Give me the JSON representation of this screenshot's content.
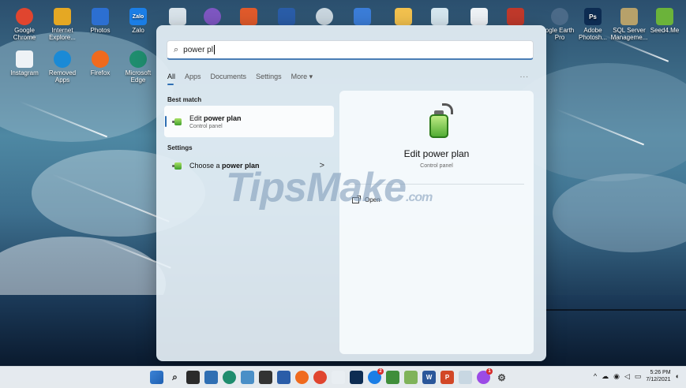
{
  "desktop": {
    "icons_left": [
      {
        "label": "Google Chrome",
        "color": "#e0452f"
      },
      {
        "label": "Internet Explore...",
        "color": "#e5a823"
      },
      {
        "label": "Photos",
        "color": "#2c6fd1"
      },
      {
        "label": "Zalo",
        "color": "#1b7ee6"
      },
      {
        "label": "Instagram",
        "color": "#3f51b5"
      },
      {
        "label": "Removed Apps",
        "color": "#1a8ad6"
      },
      {
        "label": "Firefox",
        "color": "#f06a1d"
      },
      {
        "label": "Microsoft Edge",
        "color": "#1f8d6e"
      }
    ],
    "icons_right": [
      {
        "label": "ogle Earth Pro",
        "color": "#4b6a88"
      },
      {
        "label": "Adobe Photosh...",
        "color": "#0d2c52"
      },
      {
        "label": "SQL Server Manageme...",
        "color": "#b7a16a"
      },
      {
        "label": "Seed4.Me",
        "color": "#6bb33a"
      }
    ],
    "zalo_badge": "Zalo",
    "photoshop_badge": "Ps"
  },
  "search": {
    "query": "power pl",
    "tabs": [
      {
        "label": "All",
        "active": true
      },
      {
        "label": "Apps"
      },
      {
        "label": "Documents"
      },
      {
        "label": "Settings"
      },
      {
        "label": "More ▾"
      }
    ],
    "more_menu": "...",
    "best_match_label": "Best match",
    "best_match": {
      "title_plain": "Edit ",
      "title_bold": "power plan",
      "subtitle": "Control panel"
    },
    "settings_label": "Settings",
    "settings_result": {
      "title_plain": "Choose a ",
      "title_bold": "power plan",
      "chevron": ">"
    },
    "detail": {
      "title": "Edit power plan",
      "subtitle": "Control panel",
      "action_open": "Open"
    }
  },
  "watermark": {
    "main": "TipsMake",
    "suffix": ".com"
  },
  "taskbar": {
    "badges": {
      "mail": "2",
      "messenger": "1"
    },
    "word_label": "W",
    "ppt_label": "P",
    "clock_time": "5:26 PM",
    "clock_date": "7/12/2021"
  },
  "colors": {
    "accent": "#2f6fb3",
    "panel_bg": "#e6f0f6"
  }
}
